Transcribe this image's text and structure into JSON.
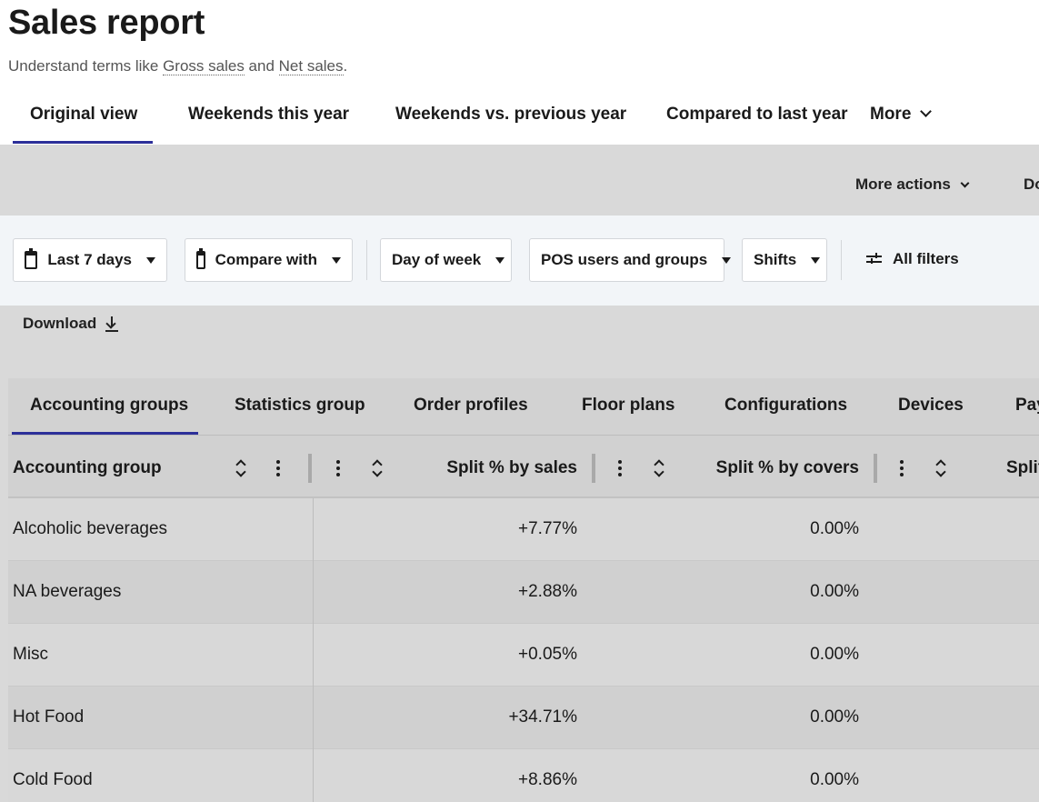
{
  "header": {
    "title": "Sales report",
    "subtitle_prefix": "Understand terms like ",
    "subtitle_term1": "Gross sales",
    "subtitle_mid": " and ",
    "subtitle_term2": "Net sales",
    "subtitle_suffix": "."
  },
  "view_tabs": [
    {
      "label": "Original view",
      "active": true
    },
    {
      "label": "Weekends this year"
    },
    {
      "label": "Weekends vs. previous year"
    },
    {
      "label": "Compared to last year"
    },
    {
      "label": "More"
    }
  ],
  "actions": {
    "more_actions": "More actions",
    "cut_label": "Do"
  },
  "filters": {
    "date_range": "Last 7 days",
    "compare_with": "Compare with",
    "day_of_week": "Day of week",
    "pos_users": "POS users and groups",
    "shifts": "Shifts",
    "all_filters": "All filters"
  },
  "download": {
    "label": "Download"
  },
  "data_tabs": [
    {
      "label": "Accounting groups",
      "active": true
    },
    {
      "label": "Statistics group"
    },
    {
      "label": "Order profiles"
    },
    {
      "label": "Floor plans"
    },
    {
      "label": "Configurations"
    },
    {
      "label": "Devices"
    },
    {
      "label": "Pay"
    }
  ],
  "table": {
    "columns": [
      {
        "label": "Accounting group"
      },
      {
        "label": "Split % by sales"
      },
      {
        "label": "Split % by covers"
      },
      {
        "label": "Split"
      }
    ],
    "rows": [
      {
        "name": "Alcoholic beverages",
        "sales": "+7.77%",
        "covers": "0.00%"
      },
      {
        "name": "NA beverages",
        "sales": "+2.88%",
        "covers": "0.00%"
      },
      {
        "name": "Misc",
        "sales": "+0.05%",
        "covers": "0.00%"
      },
      {
        "name": "Hot Food",
        "sales": "+34.71%",
        "covers": "0.00%"
      },
      {
        "name": "Cold Food",
        "sales": "+8.86%",
        "covers": "0.00%"
      }
    ]
  }
}
